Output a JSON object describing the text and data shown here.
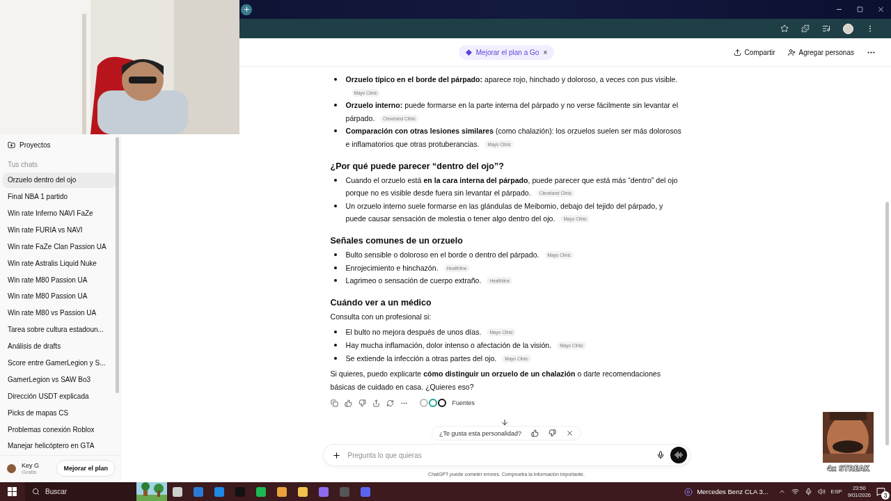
{
  "sidebar": {
    "projects_label": "Proyectos",
    "chats_heading": "Tus chats",
    "chats": [
      {
        "title": "Orzuelo dentro del ojo",
        "selected": true
      },
      {
        "title": "Final NBA 1 partido",
        "selected": false
      },
      {
        "title": "Win rate Inferno NAVI FaZe",
        "selected": false
      },
      {
        "title": "Win rate FURIA vs NAVI",
        "selected": false
      },
      {
        "title": "Win rate FaZe Clan Passion UA",
        "selected": false
      },
      {
        "title": "Win rate Astralis Liquid Nuke",
        "selected": false
      },
      {
        "title": "Win rate M80 Passion UA",
        "selected": false
      },
      {
        "title": "Win rate M80 Passion UA",
        "selected": false
      },
      {
        "title": "Win rate M80 vs Passion UA",
        "selected": false
      },
      {
        "title": "Tarea sobre cultura estadoun...",
        "selected": false
      },
      {
        "title": "Análisis de drafts",
        "selected": false
      },
      {
        "title": "Score entre GamerLegion y S...",
        "selected": false
      },
      {
        "title": "GamerLegion vs SAW Bo3",
        "selected": false
      },
      {
        "title": "Dirección USDT explicada",
        "selected": false
      },
      {
        "title": "Picks de mapas CS",
        "selected": false
      },
      {
        "title": "Problemas conexión Roblox",
        "selected": false
      },
      {
        "title": "Manejar helicóptero en GTA",
        "selected": false
      }
    ],
    "user": {
      "name": "Key G",
      "plan": "Gratis"
    },
    "upgrade_button": "Mejorar el plan"
  },
  "header": {
    "upgrade_pill": "Mejorar el plan a Go",
    "pill_close": "×",
    "share": "Compartir",
    "add_people": "Agregar personas"
  },
  "message": {
    "blocks": [
      {
        "kind": "list",
        "items": [
          {
            "text": "**Orzuelo típico en el borde del párpado:** aparece rojo, hinchado y doloroso, a veces con pus visible.",
            "source": "Mayo Clinic"
          },
          {
            "text": "**Orzuelo interno:** puede formarse en la parte interna del párpado y no verse fácilmente sin levantar el párpado.",
            "source": "Cleveland Clinic"
          },
          {
            "text": "**Comparación con otras lesiones similares** (como chalazión): los orzuelos suelen ser más dolorosos e inflamatorios que otras protuberancias.",
            "source": "Mayo Clinic"
          }
        ]
      },
      {
        "kind": "heading",
        "text": "¿Por qué puede parecer “dentro del ojo”?"
      },
      {
        "kind": "list",
        "items": [
          {
            "text": "Cuando el orzuelo está **en la cara interna del párpado**, puede parecer que está más “dentro” del ojo porque no es visible desde fuera sin levantar el párpado.",
            "source": "Cleveland Clinic"
          },
          {
            "text": "Un orzuelo interno suele formarse en las glándulas de Meibomio, debajo del tejido del párpado, y puede causar sensación de molestia o tener algo dentro del ojo.",
            "source": "Mayo Clinic"
          }
        ]
      },
      {
        "kind": "heading",
        "text": "Señales comunes de un orzuelo"
      },
      {
        "kind": "list",
        "items": [
          {
            "text": "Bulto sensible o doloroso en el borde o dentro del párpado.",
            "source": "Mayo Clinic"
          },
          {
            "text": "Enrojecimiento e hinchazón.",
            "source": "Healthline"
          },
          {
            "text": "Lagrimeo o sensación de cuerpo extraño.",
            "source": "Healthline"
          }
        ]
      },
      {
        "kind": "heading",
        "text": "Cuándo ver a un médico"
      },
      {
        "kind": "paragraph",
        "text": "Consulta con un profesional si:"
      },
      {
        "kind": "list",
        "items": [
          {
            "text": "El bulto no mejora después de unos días.",
            "source": "Mayo Clinic"
          },
          {
            "text": "Hay mucha inflamación, dolor intenso o afectación de la visión.",
            "source": "Mayo Clinic"
          },
          {
            "text": "Se extiende la infección a otras partes del ojo.",
            "source": "Mayo Clinic"
          }
        ]
      },
      {
        "kind": "paragraph",
        "text": "Si quieres, puedo explicarte **cómo distinguir un orzuelo de un chalazión** o darte recomendaciones básicas de cuidado en casa. ¿Quieres eso?"
      }
    ],
    "sources_label": "Fuentes"
  },
  "feedback": {
    "question": "¿Te gusta esta personalidad?"
  },
  "composer": {
    "placeholder": "Pregunta lo que quieras",
    "disclaimer": "ChatGPT puede cometer errores. Comprueba la información importante."
  },
  "overlay": {
    "streak": "4x STREAK"
  },
  "taskbar": {
    "search_placeholder": "Buscar",
    "media": "Mercedes Benz CLA 3...",
    "language": "ESP",
    "time": "23:50",
    "date": "9/01/2026",
    "notifications": "3"
  }
}
